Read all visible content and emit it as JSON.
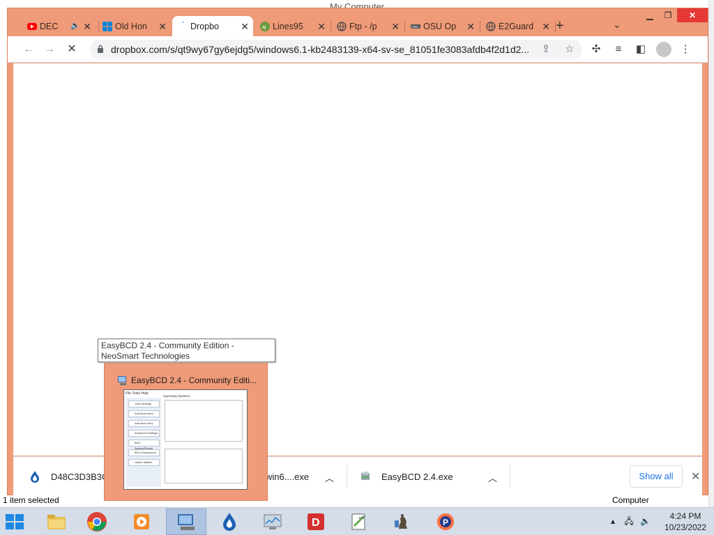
{
  "background_window": {
    "title": "My Computer",
    "status_left": "1 item selected",
    "status_right": "Computer"
  },
  "browser": {
    "tabs": [
      {
        "label": "DEC",
        "icon": "youtube-icon",
        "muted": true
      },
      {
        "label": "Old Hon",
        "icon": "windows-icon"
      },
      {
        "label": "Dropbo",
        "icon": "loading-icon",
        "active": true
      },
      {
        "label": "Lines95",
        "icon": "aj-icon"
      },
      {
        "label": "Ftp - /p",
        "icon": "globe-icon"
      },
      {
        "label": "OSU Op",
        "icon": "osu-icon"
      },
      {
        "label": "E2Guard",
        "icon": "globe-icon"
      }
    ],
    "new_tab": "+",
    "url": "dropbox.com/s/qt9wy67gy6ejdg5/windows6.1-kb2483139-x64-sv-se_81051fe3083afdb4f2d1d2..."
  },
  "downloads": [
    {
      "name": "D48C3D3B3CF",
      "icon": "dropbox-drop-icon"
    },
    {
      "name": "win6....exe",
      "icon": "file-icon"
    },
    {
      "name": "EasyBCD 2.4.exe",
      "icon": "installer-icon"
    }
  ],
  "show_all_label": "Show all",
  "tooltip": "EasyBCD 2.4 - Community Edition - NeoSmart Technologies",
  "thumbnail": {
    "title": "EasyBCD 2.4 - Community Editi...",
    "preview_menu": "File   Tools   Help",
    "preview_section": "Operating Systems",
    "preview_buttons": [
      "View Settings",
      "Edit Boot Menu",
      "Add New Entry",
      "Advanced Settings",
      "BCD Backup/Repair",
      "BCD Deployment",
      "Useful Utilities"
    ]
  },
  "taskbar": {
    "time": "4:24 PM",
    "date": "10/23/2022"
  },
  "colors": {
    "chrome_frame": "#ef9a78",
    "accent_blue": "#1a73e8"
  }
}
